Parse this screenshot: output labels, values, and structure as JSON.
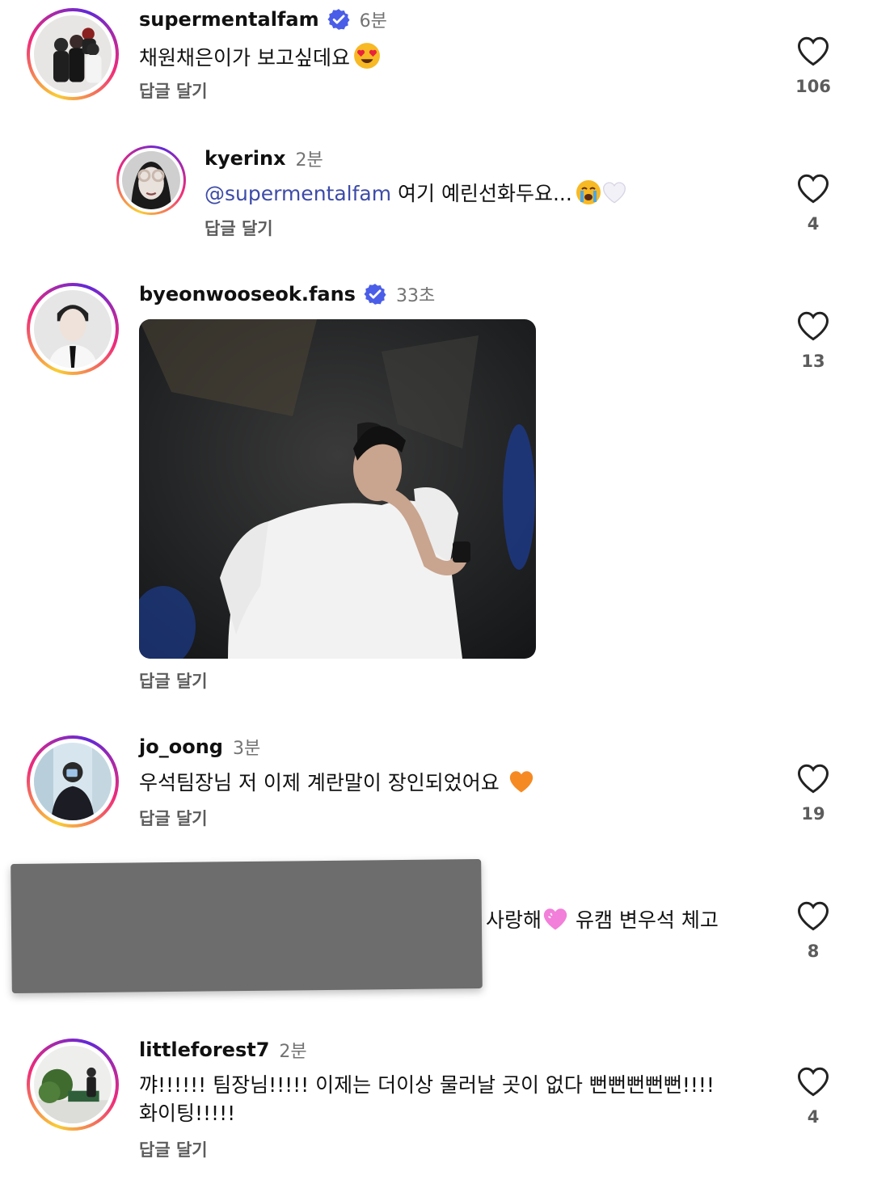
{
  "colors": {
    "verified": "#4a5de8",
    "mention": "#3d4ba8",
    "meta": "#737373"
  },
  "comments": [
    {
      "username": "supermentalfam",
      "verified": true,
      "time": "6분",
      "text": "채원채은이가 보고싶데요",
      "emoji": "heart-eyes",
      "reply_label": "답글 달기",
      "likes": "106"
    },
    {
      "username": "kyerinx",
      "verified": false,
      "time": "2분",
      "mention": "@supermentalfam",
      "text": " 여기 예린선화두요...",
      "emoji": "crying-face white-heart",
      "reply_label": "답글 달기",
      "likes": "4"
    },
    {
      "username": "byeonwooseok.fans",
      "verified": true,
      "time": "33초",
      "text": "",
      "reply_label": "답글 달기",
      "likes": "13"
    },
    {
      "username": "jo_oong",
      "verified": false,
      "time": "3분",
      "text": "우석팀장님 저 이제 계란말이 장인되었어요",
      "emoji": "orange-heart",
      "reply_label": "답글 달기",
      "likes": "19"
    },
    {
      "username": "",
      "verified": false,
      "time": "",
      "text_a": "사랑해",
      "emoji": "pink-heart",
      "text_b": " 유캠 변우석 체고",
      "likes": "8"
    },
    {
      "username": "littleforest7",
      "verified": false,
      "time": "2분",
      "text_line1": "꺄!!!!!! 팀장님!!!!! 이제는 더이상 물러날 곳이 없다 뻔뻔뻔뻔뻔!!!!",
      "text_line2": "화이팅!!!!!",
      "reply_label": "답글 달기",
      "likes": "4"
    }
  ]
}
